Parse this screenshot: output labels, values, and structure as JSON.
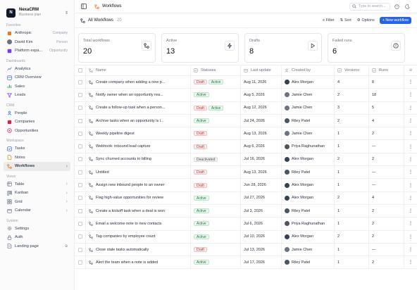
{
  "workspace": {
    "name": "NexaCRM",
    "plan": "Business plan"
  },
  "sidebar": {
    "favorites_label": "Favorites",
    "favorites": [
      {
        "label": "Anthropic",
        "meta": "Company",
        "icon": "company-icon",
        "color": "#f97316"
      },
      {
        "label": "David Kim",
        "meta": "Person",
        "icon": "person-icon",
        "color": "#6b7280"
      },
      {
        "label": "Platform expa...",
        "meta": "Opportunity",
        "icon": "opportunity-icon",
        "color": "#7c3aed"
      }
    ],
    "dashboards_label": "Dashboards",
    "dashboards": [
      {
        "label": "Analytics",
        "icon": "chart-icon"
      },
      {
        "label": "CRM Overview",
        "icon": "dashboard-icon"
      },
      {
        "label": "Sales",
        "icon": "bar-chart-icon"
      },
      {
        "label": "Leads",
        "icon": "funnel-icon"
      }
    ],
    "crm_label": "CRM",
    "crm": [
      {
        "label": "People",
        "icon": "person-icon",
        "color": "#2563eb"
      },
      {
        "label": "Companies",
        "icon": "company-icon",
        "color": "#e11d48"
      },
      {
        "label": "Opportunities",
        "icon": "target-icon",
        "color": "#db2777"
      }
    ],
    "workspace_label": "Workspace",
    "workspace_items": [
      {
        "label": "Tasks",
        "icon": "check-icon"
      },
      {
        "label": "Notes",
        "icon": "note-icon"
      },
      {
        "label": "Workflows",
        "icon": "workflow-icon",
        "active": true
      }
    ],
    "views_label": "Views",
    "views": [
      {
        "label": "Table",
        "icon": "table-icon"
      },
      {
        "label": "Kanban",
        "icon": "kanban-icon"
      },
      {
        "label": "Grid",
        "icon": "grid-icon"
      },
      {
        "label": "Calendar",
        "icon": "calendar-icon"
      }
    ],
    "system_label": "System",
    "system": [
      {
        "label": "Settings",
        "icon": "gear-icon"
      },
      {
        "label": "Auth",
        "icon": "lock-icon"
      },
      {
        "label": "Landing page",
        "icon": "page-icon"
      }
    ]
  },
  "topbar": {
    "crumb": "Workflows",
    "search_placeholder": "Type to search..."
  },
  "viewbar": {
    "title": "All Workflows",
    "count": "20",
    "filter": "Filter",
    "sort": "Sort",
    "options": "Options",
    "new": "+ New workflow"
  },
  "stats": [
    {
      "label": "Total workflows",
      "value": "20",
      "icon": "workflow-icon"
    },
    {
      "label": "Active",
      "value": "13",
      "icon": "bolt-icon"
    },
    {
      "label": "Drafts",
      "value": "8",
      "icon": "play-icon"
    },
    {
      "label": "Failed runs",
      "value": "6",
      "icon": "alert-icon"
    }
  ],
  "table": {
    "headers": [
      "Name",
      "Statuses",
      "Last update",
      "Created by",
      "Versions",
      "Runs"
    ],
    "rows": [
      {
        "name": "Create company when adding a new p...",
        "statuses": [
          "Draft",
          "Active"
        ],
        "date": "Aug 11, 2026",
        "by": "Alex Morgan",
        "versions": "4",
        "runs": "8"
      },
      {
        "name": "Notify owner when an opportunity rea...",
        "statuses": [
          "Active"
        ],
        "date": "Aug 5, 2026",
        "by": "Jamie Chen",
        "versions": "2",
        "runs": "18"
      },
      {
        "name": "Create a follow-up task when a person...",
        "statuses": [
          "Draft",
          "Active"
        ],
        "date": "Aug 12, 2026",
        "by": "Jamie Chen",
        "versions": "3",
        "runs": "5"
      },
      {
        "name": "Archive tasks when an opportunity is l...",
        "statuses": [
          "Active"
        ],
        "date": "Jul 24, 2026",
        "by": "Riley Patel",
        "versions": "2",
        "runs": "4"
      },
      {
        "name": "Weekly pipeline digest",
        "statuses": [
          "Draft"
        ],
        "date": "Aug 13, 2026",
        "by": "Jamie Chen",
        "versions": "1",
        "runs": "2"
      },
      {
        "name": "Webhook: inbound lead capture",
        "statuses": [
          "Draft"
        ],
        "date": "Aug 6, 2026",
        "by": "Priya Raghunathan",
        "versions": "1",
        "runs": "—"
      },
      {
        "name": "Sync churned accounts to billing",
        "statuses": [
          "Deactivated"
        ],
        "date": "Jul 16, 2026",
        "by": "Alex Morgan",
        "versions": "2",
        "runs": "2"
      },
      {
        "name": "Untitled",
        "statuses": [
          "Draft"
        ],
        "date": "Aug 13, 2026",
        "by": "Riley Patel",
        "versions": "1",
        "runs": "—"
      },
      {
        "name": "Assign new inbound people to an owner",
        "statuses": [
          "Draft"
        ],
        "date": "Jun 28, 2026",
        "by": "Alex Morgan",
        "versions": "1",
        "runs": "—"
      },
      {
        "name": "Flag high-value opportunities for review",
        "statuses": [
          "Active"
        ],
        "date": "Jul 27, 2026",
        "by": "Alex Morgan",
        "versions": "2",
        "runs": "4"
      },
      {
        "name": "Create a kickoff task when a deal is won",
        "statuses": [
          "Active"
        ],
        "date": "Jul 3, 2026",
        "by": "Riley Patel",
        "versions": "1",
        "runs": "2"
      },
      {
        "name": "Email a welcome note to new contacts",
        "statuses": [
          "Active"
        ],
        "date": "Jul 6, 2026",
        "by": "Priya Raghunathan",
        "versions": "1",
        "runs": "2"
      },
      {
        "name": "Tag companies by employee count",
        "statuses": [
          "Active"
        ],
        "date": "Jul 10, 2026",
        "by": "Alex Morgan",
        "versions": "2",
        "runs": "2"
      },
      {
        "name": "Close stale tasks automatically",
        "statuses": [
          "Draft"
        ],
        "date": "Jul 13, 2026",
        "by": "Jamie Chen",
        "versions": "1",
        "runs": "—"
      },
      {
        "name": "Alert the team when a note is added",
        "statuses": [
          "Active"
        ],
        "date": "Jul 17, 2026",
        "by": "Riley Patel",
        "versions": "1",
        "runs": "2"
      }
    ]
  }
}
